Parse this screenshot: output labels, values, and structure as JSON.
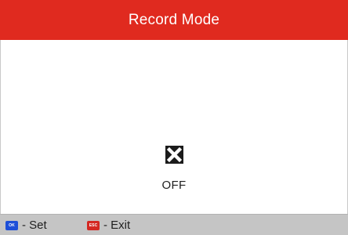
{
  "header": {
    "title": "Record Mode"
  },
  "main": {
    "status_icon": "x-mark-icon",
    "status_text": "OFF"
  },
  "footer": {
    "set": {
      "key_label": "OK",
      "text": "- Set"
    },
    "exit": {
      "key_label": "ESC",
      "text": "- Exit"
    }
  },
  "colors": {
    "header_bg": "#e02a1f",
    "footer_bg": "#c5c5c5",
    "ok_key": "#1d4fd8",
    "esc_key": "#d42822"
  }
}
